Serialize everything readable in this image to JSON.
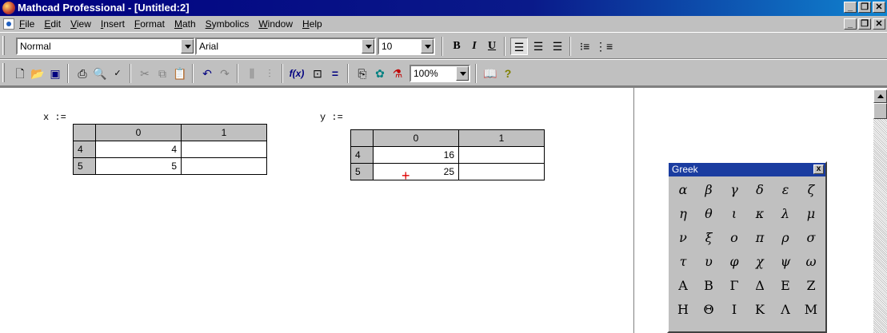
{
  "window": {
    "title": "Mathcad Professional - [Untitled:2]",
    "min": "_",
    "max": "▫",
    "close": "✕"
  },
  "menu": [
    "File",
    "Edit",
    "View",
    "Insert",
    "Format",
    "Math",
    "Symbolics",
    "Window",
    "Help"
  ],
  "format_toolbar": {
    "style": "Normal",
    "font": "Arial",
    "size": "10",
    "bold": "B",
    "italic": "I",
    "underline": "U"
  },
  "standard_toolbar": {
    "zoom": "100%"
  },
  "worksheet": {
    "x": {
      "label": "x :=",
      "cols": [
        "0",
        "1"
      ],
      "rows": [
        {
          "idx": "4",
          "c0": "4",
          "c1": ""
        },
        {
          "idx": "5",
          "c0": "5",
          "c1": ""
        }
      ]
    },
    "y": {
      "label": "y :=",
      "cols": [
        "0",
        "1"
      ],
      "rows": [
        {
          "idx": "4",
          "c0": "16",
          "c1": ""
        },
        {
          "idx": "5",
          "c0": "25",
          "c1": ""
        }
      ]
    },
    "cursor": "+"
  },
  "greek_palette": {
    "title": "Greek",
    "close": "x",
    "lower": [
      "α",
      "β",
      "γ",
      "δ",
      "ε",
      "ζ",
      "η",
      "θ",
      "ι",
      "κ",
      "λ",
      "μ",
      "ν",
      "ξ",
      "ο",
      "π",
      "ρ",
      "σ",
      "τ",
      "υ",
      "φ",
      "χ",
      "ψ",
      "ω"
    ],
    "upper": [
      "Α",
      "Β",
      "Γ",
      "Δ",
      "Ε",
      "Ζ",
      "Η",
      "Θ",
      "Ι",
      "Κ",
      "Λ",
      "Μ"
    ]
  }
}
